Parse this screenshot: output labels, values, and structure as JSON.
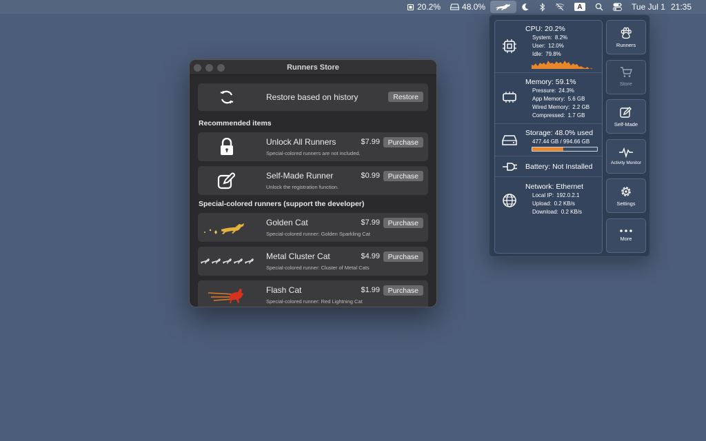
{
  "menubar": {
    "cpu": "20.2%",
    "disk": "48.0%",
    "date": "Tue Jul 1",
    "time": "21:35",
    "input_source": "A"
  },
  "store_window": {
    "title": "Runners Store",
    "restore": {
      "label": "Restore based on history",
      "button": "Restore"
    },
    "recommended_heading": "Recommended items",
    "recommended": [
      {
        "title": "Unlock All Runners",
        "price": "$7.99",
        "subtitle": "Special-colored runners are not included.",
        "button": "Purchase",
        "icon": "lock-icon"
      },
      {
        "title": "Self-Made Runner",
        "price": "$0.99",
        "subtitle": "Unlock the registration function.",
        "button": "Purchase",
        "icon": "edit-icon"
      }
    ],
    "special_heading": "Special-colored runners (support the developer)",
    "special": [
      {
        "title": "Golden Cat",
        "price": "$7.99",
        "subtitle": "Special-colored runner: Golden Sparkling Cat",
        "button": "Purchase",
        "icon": "golden-cat-icon"
      },
      {
        "title": "Metal Cluster Cat",
        "price": "$4.99",
        "subtitle": "Special-colored runner: Cluster of Metal Cats",
        "button": "Purchase",
        "icon": "metal-cats-icon"
      },
      {
        "title": "Flash Cat",
        "price": "$1.99",
        "subtitle": "Special-colored runner: Red Lightning Cat",
        "button": "Purchase",
        "icon": "flash-cat-icon"
      }
    ]
  },
  "system_panel": {
    "cpu": {
      "title": "CPU: 20.2%",
      "lines": [
        [
          "System:",
          "8.2%"
        ],
        [
          "User:",
          "12.0%"
        ],
        [
          "Idle:",
          "79.8%"
        ]
      ]
    },
    "memory": {
      "title": "Memory: 59.1%",
      "lines": [
        [
          "Pressure:",
          "24.3%"
        ],
        [
          "App Memory:",
          "5.6 GB"
        ],
        [
          "Wired Memory:",
          "2.2 GB"
        ],
        [
          "Compressed:",
          "1.7 GB"
        ]
      ]
    },
    "storage": {
      "title": "Storage: 48.0% used",
      "detail": "477.44 GB / 994.66 GB",
      "used_fraction": 0.48
    },
    "battery": {
      "title": "Battery: Not Installed"
    },
    "network": {
      "title": "Network: Ethernet",
      "lines": [
        [
          "Local IP:",
          "192.0.2.1"
        ],
        [
          "Upload:",
          "0.2 KB/s"
        ],
        [
          "Download:",
          "0.2 KB/s"
        ]
      ]
    },
    "buttons": [
      "Runners",
      "Store",
      "Self-Made",
      "Activity Monitor",
      "Settings",
      "More"
    ]
  },
  "colors": {
    "accent": "#e8862a",
    "desktop": "#4c5d79",
    "panel": "#2f3d52"
  }
}
